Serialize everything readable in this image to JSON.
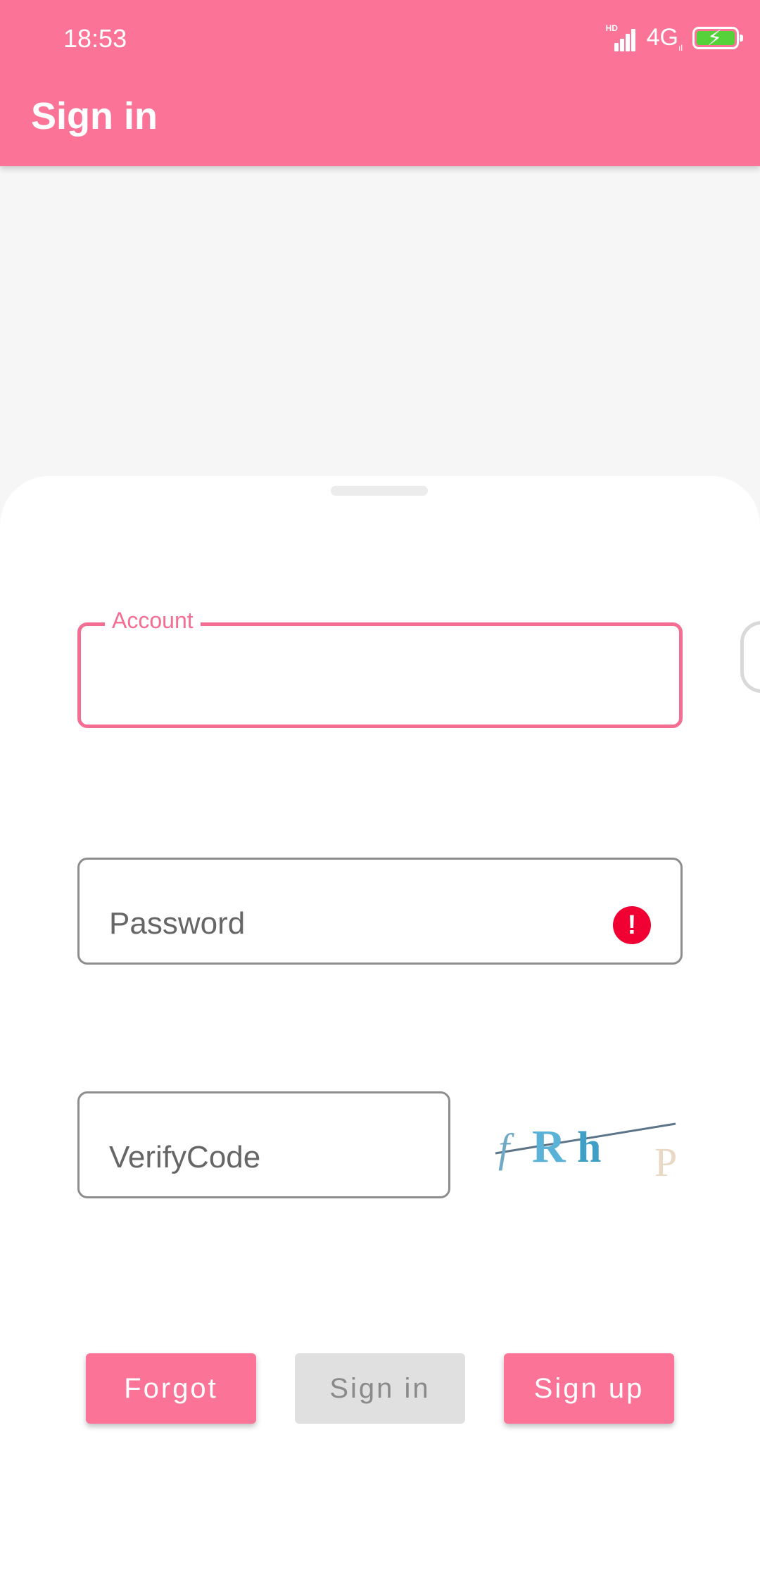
{
  "status_bar": {
    "time": "18:53",
    "network_hd": "HD",
    "network": "4G",
    "network_sub": "ıl"
  },
  "app_bar": {
    "title": "Sign in"
  },
  "form": {
    "account_label": "Account",
    "account_value": "",
    "password_placeholder": "Password",
    "verify_placeholder": "VerifyCode",
    "captcha_chars": [
      "f",
      "R",
      "h",
      "P"
    ]
  },
  "buttons": {
    "forgot": "Forgot",
    "sign_in": "Sign in",
    "sign_up": "Sign up"
  },
  "colors": {
    "accent": "#fb7498",
    "error": "#f00033",
    "disabled": "#e0e0e0"
  }
}
